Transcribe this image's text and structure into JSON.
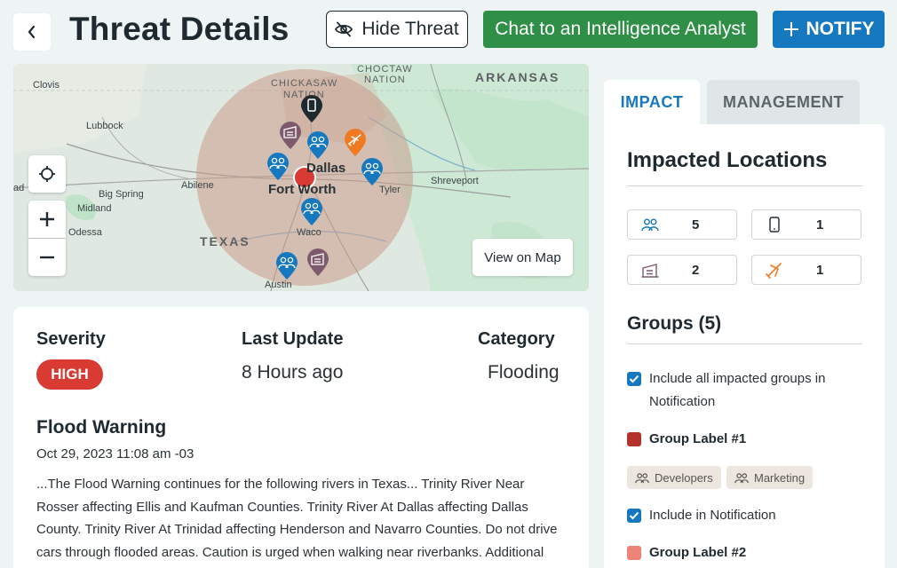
{
  "header": {
    "title": "Threat Details",
    "hide_label": "Hide Threat",
    "chat_label": "Chat to an Intelligence Analyst",
    "notify_label": "NOTIFY"
  },
  "map": {
    "labels": {
      "clovis": "Clovis",
      "lubbock": "Lubbock",
      "big_spring": "Big Spring",
      "midland": "Midland",
      "odessa": "Odessa",
      "abilene": "Abilene",
      "dallas": "Dallas",
      "fort_worth": "Fort Worth",
      "tyler": "Tyler",
      "shreveport": "Shreveport",
      "waco": "Waco",
      "austin": "Austin",
      "texas": "TEXAS",
      "arkansas": "ARKANSAS",
      "chickasaw": "CHICKASAW",
      "nation1": "NATION",
      "choctaw": "CHOCTAW",
      "nation2": "NATION",
      "ad": "ad"
    },
    "view_map_label": "View on Map",
    "colors": {
      "threat_radius": "#c89a8a",
      "pin_group": "#1678bf",
      "pin_building": "#7d5a6c",
      "pin_travel": "#f07a22",
      "pin_device": "#1f2a30"
    }
  },
  "threat": {
    "severity_heading": "Severity",
    "severity": "HIGH",
    "update_heading": "Last Update",
    "update": "8 Hours ago",
    "category_heading": "Category",
    "category": "Flooding",
    "title": "Flood Warning",
    "date": "Oct 29, 2023 11:08 am -03",
    "body_lines": [
      "...The Flood Warning continues for the following rivers in Texas... Trinity River Near",
      "Rosser affecting Ellis and Kaufman Counties. Trinity River At Dallas affecting Dallas",
      "County. Trinity River At Trinidad affecting Henderson and Navarro Counties. Do not drive",
      "cars through flooded areas. Caution is urged when walking near riverbanks. Additional"
    ]
  },
  "panel": {
    "tab_impact": "IMPACT",
    "tab_management": "MANAGEMENT",
    "impacted_title": "Impacted Locations",
    "stats": {
      "groups": "5",
      "devices": "1",
      "buildings": "2",
      "travel": "1"
    },
    "groups_title": "Groups (5)",
    "include_all_line1": "Include all impacted groups in",
    "include_all_line2": "Notification",
    "group1_label": "Group Label #1",
    "group1_color": "#b3322a",
    "chips": [
      "Developers",
      "Marketing"
    ],
    "include_label": "Include in Notification",
    "group2_label": "Group Label #2",
    "group2_color": "#ee8378"
  }
}
